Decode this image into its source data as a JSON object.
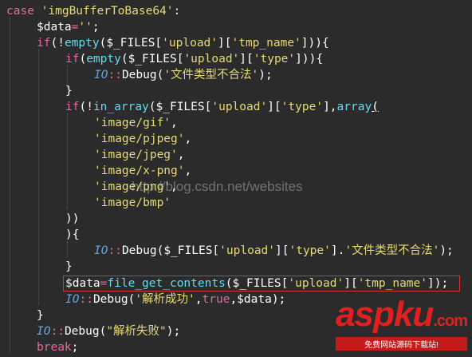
{
  "code": {
    "l1": {
      "kw": "case",
      "str": "'imgBufferToBase64'",
      "punc": ":"
    },
    "l2": {
      "var": "$data",
      "op": "=",
      "str": "''",
      "punc": ";"
    },
    "l3": {
      "kw": "if",
      "p1": "(!",
      "fn": "empty",
      "p2": "($_FILES[",
      "s1": "'upload'",
      "p3": "][",
      "s2": "'tmp_name'",
      "p4": "])){"
    },
    "l4": {
      "kw": "if",
      "p1": "(",
      "fn": "empty",
      "p2": "($_FILES[",
      "s1": "'upload'",
      "p3": "][",
      "s2": "'type'",
      "p4": "])){"
    },
    "l5": {
      "cls": "IO",
      "op": "::",
      "fn": "Debug",
      "p1": "(",
      "str": "'文件类型不合法'",
      "p2": ");"
    },
    "l6": {
      "punc": "}"
    },
    "l7": {
      "kw": "if",
      "p1": "(!",
      "fn": "in_array",
      "p2": "($_FILES[",
      "s1": "'upload'",
      "p3": "][",
      "s2": "'type'",
      "p4": "],",
      "fn2": "array",
      "p5": "("
    },
    "l8": {
      "str": "'image/gif'",
      "punc": ","
    },
    "l9": {
      "str": "'image/pjpeg'",
      "punc": ","
    },
    "l10": {
      "str": "'image/jpeg'",
      "punc": ","
    },
    "l11": {
      "str": "'image/x-png'",
      "punc": ","
    },
    "l12": {
      "str": "'image/png'",
      "punc": ","
    },
    "l13": {
      "str": "'image/bmp'"
    },
    "l14": {
      "punc": "))"
    },
    "l15": {
      "punc": "){"
    },
    "l16": {
      "cls": "IO",
      "op": "::",
      "fn": "Debug",
      "p1": "($_FILES[",
      "s1": "'upload'",
      "p2": "][",
      "s2": "'type'",
      "p3": "].",
      "s3": "'文件类型不合法'",
      "p4": ");"
    },
    "l17": {
      "punc": "}"
    },
    "l18": {
      "var": "$data",
      "op": "=",
      "fn": "file_get_contents",
      "p1": "($_FILES[",
      "s1": "'upload'",
      "p2": "][",
      "s2": "'tmp_name'",
      "p3": "]);"
    },
    "l19": {
      "cls": "IO",
      "op": "::",
      "fn": "Debug",
      "p1": "(",
      "s1": "'解析成功'",
      "p2": ",",
      "kw": "true",
      "p3": ",$data);"
    },
    "l20": {
      "punc": "}"
    },
    "l21": {
      "cls": "IO",
      "op": "::",
      "fn": "Debug",
      "p1": "(",
      "str": "\"解析失败\"",
      "p2": ");"
    },
    "l22": {
      "kw": "break",
      "punc": ";"
    }
  },
  "watermark": "http://blog.csdn.net/websites",
  "logo": {
    "main": "aspku",
    "tld": ".com",
    "sub": "免费网站源码下载站!"
  }
}
